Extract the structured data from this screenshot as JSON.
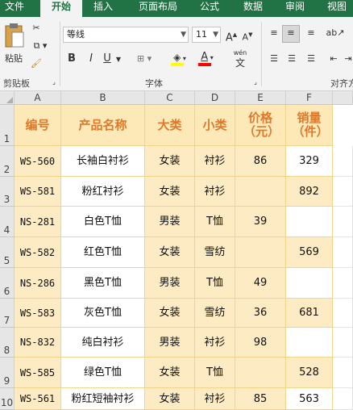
{
  "tabs": [
    "文件",
    "开始",
    "插入",
    "页面布局",
    "公式",
    "数据",
    "审阅",
    "视图"
  ],
  "ribbon": {
    "paste": "粘贴",
    "clipboard": "剪贴板",
    "font_name": "等线",
    "font_size": "11",
    "grow": "A",
    "shrink": "A",
    "bold": "B",
    "italic": "I",
    "underline": "U",
    "font_group": "字体",
    "align_group": "对齐方",
    "phonetic": "wén",
    "phonetic_char": "文",
    "font_color": "#ff0000",
    "fill_color": "#ffff00"
  },
  "sheet": {
    "columns": [
      "A",
      "B",
      "C",
      "D",
      "E",
      "F"
    ],
    "rows": [
      "1",
      "2",
      "3",
      "4",
      "5",
      "6",
      "7",
      "8",
      "9",
      "10"
    ],
    "header": [
      "编号",
      "产品名称",
      "大类",
      "小类",
      "价格（元）",
      "销量（件）"
    ],
    "data": [
      [
        "WS-560",
        "长袖白衬衫",
        "女装",
        "衬衫",
        "86",
        "329"
      ],
      [
        "WS-581",
        "粉红衬衫",
        "女装",
        "衬衫",
        "",
        "892"
      ],
      [
        "NS-281",
        "白色T恤",
        "男装",
        "T恤",
        "39",
        ""
      ],
      [
        "WS-582",
        "红色T恤",
        "女装",
        "雪纺",
        "",
        "569"
      ],
      [
        "NS-286",
        "黑色T恤",
        "男装",
        "T恤",
        "49",
        ""
      ],
      [
        "WS-583",
        "灰色T恤",
        "女装",
        "雪纺",
        "36",
        "681"
      ],
      [
        "NS-832",
        "纯白衬衫",
        "男装",
        "衬衫",
        "98",
        ""
      ],
      [
        "WS-585",
        "绿色T恤",
        "女装",
        "T恤",
        "",
        "528"
      ],
      [
        "WS-561",
        "粉红短袖衬衫",
        "女装",
        "衬衫",
        "85",
        "563"
      ]
    ],
    "colors": {
      "header_fill": "#fde9b8",
      "row_fill": "#fdebc3",
      "white": "#ffffff",
      "header_text": "#e0792a"
    }
  }
}
